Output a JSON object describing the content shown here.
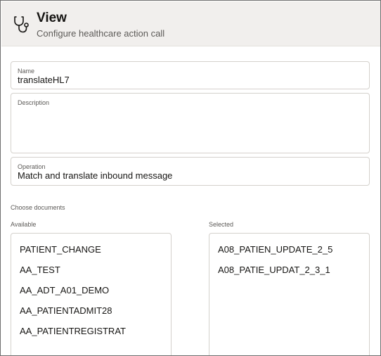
{
  "header": {
    "title": "View",
    "subtitle": "Configure healthcare action call",
    "icon": "stethoscope-icon"
  },
  "form": {
    "name": {
      "label": "Name",
      "value": "translateHL7"
    },
    "description": {
      "label": "Description",
      "value": ""
    },
    "operation": {
      "label": "Operation",
      "value": "Match and translate inbound message"
    }
  },
  "documents": {
    "section_label": "Choose documents",
    "available_label": "Available",
    "selected_label": "Selected",
    "available": [
      "PATIENT_CHANGE",
      "AA_TEST",
      "AA_ADT_A01_DEMO",
      "AA_PATIENTADMIT28",
      "AA_PATIENTREGISTRAT"
    ],
    "selected": [
      "A08_PATIEN_UPDATE_2_5",
      "A08_PATIE_UPDAT_2_3_1"
    ]
  }
}
